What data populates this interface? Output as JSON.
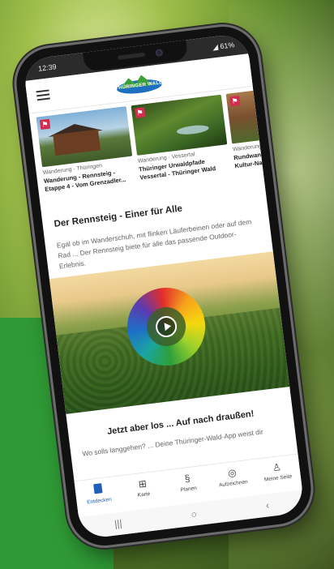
{
  "status_bar": {
    "time": "12:39",
    "battery": "61%"
  },
  "app": {
    "logo_text": "THÜRINGER WALD"
  },
  "cards": [
    {
      "meta": "Wanderung · Thüringen",
      "title_line1": "Wanderung - Rennsteig -",
      "title_line2": "Etappe 4 - Vom Grenzadler..."
    },
    {
      "meta": "Wanderung · Vessertal",
      "title_line1": "Thüringer Urwaldpfade",
      "title_line2": "Vessertal - Thüringer Wald"
    },
    {
      "meta": "Wanderung",
      "title_line1": "Rundwand",
      "title_line2": "Kultur-Na"
    }
  ],
  "section": {
    "title": "Der Rennsteig - Einer für Alle",
    "text": "Egal ob im Wanderschuh, mit flinken Läuferbeinen oder auf dem Rad ... Der Rennsteig biete für alle das passende Outdoor-Erlebnis."
  },
  "cta": {
    "title": "Jetzt aber los ... Auf nach draußen!",
    "text": "Wo solls langgehen? ... Deine Thüringer-Wald-App weist dir"
  },
  "bottom_nav": [
    {
      "label": "Entdecken",
      "icon": "book-icon",
      "active": true
    },
    {
      "label": "Karte",
      "icon": "map-icon"
    },
    {
      "label": "Planen",
      "icon": "route-icon"
    },
    {
      "label": "Aufzeichnen",
      "icon": "record-icon"
    },
    {
      "label": "Meine Seite",
      "icon": "user-icon"
    }
  ],
  "android_nav": {
    "recents": "|||",
    "home": "○",
    "back": "‹"
  },
  "colors": {
    "accent": "#1f5fb8",
    "hike_badge": "#d22d4e"
  }
}
